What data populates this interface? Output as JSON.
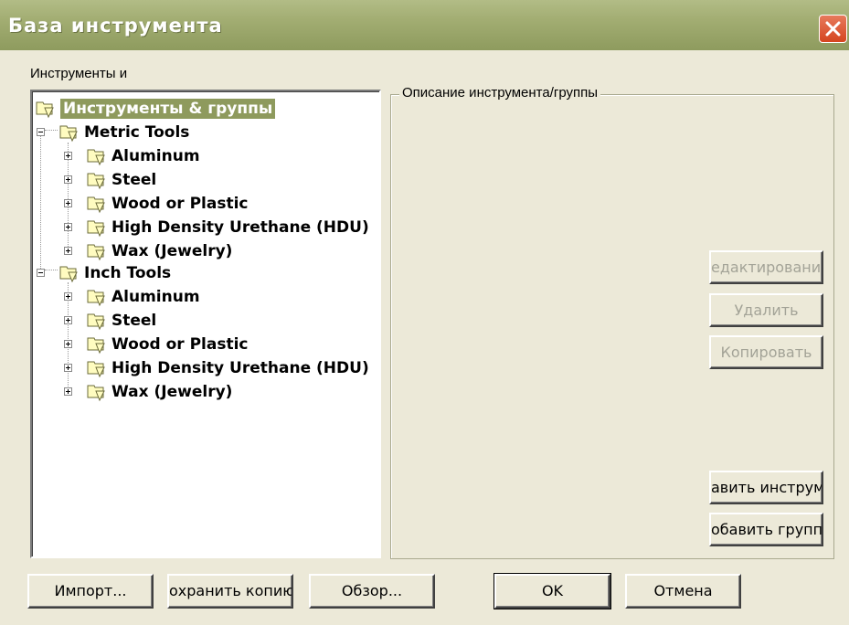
{
  "window": {
    "title": "База инструмента"
  },
  "labels": {
    "tools_and": "Инструменты и",
    "description_group": "Описание инструмента/группы"
  },
  "tree": {
    "root": "Инструменты & группы",
    "metric": "Metric Tools",
    "metric_children": [
      "Aluminum",
      "Steel",
      "Wood or Plastic",
      "High Density Urethane (HDU)",
      "Wax (Jewelry)"
    ],
    "inch": "Inch Tools",
    "inch_children": [
      "Aluminum",
      "Steel",
      "Wood or Plastic",
      "High Density Urethane (HDU)",
      "Wax (Jewelry)"
    ]
  },
  "side_buttons": {
    "edit": "едактирование",
    "delete": "Удалить",
    "copy": "Копировать",
    "add_tool": "авить инструм",
    "add_group": "обавить групп"
  },
  "bottom_buttons": {
    "import": "Импорт...",
    "save_copy": "охранить копию",
    "browse": "Обзор...",
    "ok": "OK",
    "cancel": "Отмена"
  },
  "colors": {
    "titlebar": "#9ca86a",
    "selection": "#8e9a5d",
    "close": "#d9532e"
  }
}
